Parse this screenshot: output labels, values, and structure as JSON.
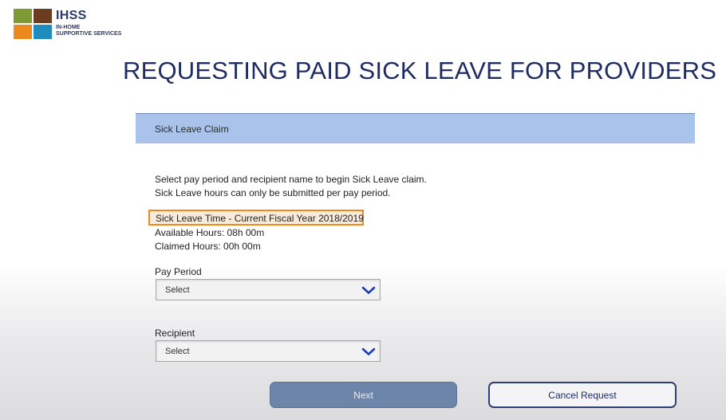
{
  "logo": {
    "title": "IHSS",
    "subtitle_line1": "IN-HOME",
    "subtitle_line2": "SUPPORTIVE SERVICES",
    "colors": [
      "#7d9a35",
      "#6b3c1e",
      "#ec8a1d",
      "#1e8cbf"
    ]
  },
  "page_title": "REQUESTING PAID SICK LEAVE FOR PROVIDERS",
  "panel": {
    "header": "Sick Leave Claim",
    "instruction_line1": "Select pay period and recipient name to begin Sick Leave claim.",
    "instruction_line2": "Sick Leave hours can only be submitted per pay period.",
    "highlight_text": "Sick Leave Time - Current Fiscal Year 2018/2019",
    "available_hours": "Available Hours: 08h 00m",
    "claimed_hours": "Claimed Hours: 00h 00m"
  },
  "form": {
    "pay_period_label": "Pay Period",
    "pay_period_value": "Select",
    "recipient_label": "Recipient",
    "recipient_value": "Select"
  },
  "buttons": {
    "next": "Next",
    "cancel": "Cancel Request"
  },
  "icons": {
    "dropdown": "chevron-down-icon"
  },
  "colors": {
    "header_bar": "#a9c3ea",
    "highlight_border": "#ec8a1d",
    "title": "#1f2d63",
    "next_button": "#6d85a9",
    "chevron": "#1c3db3"
  }
}
